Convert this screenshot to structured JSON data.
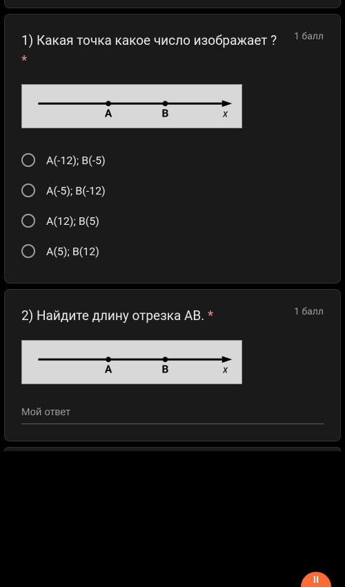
{
  "questions": [
    {
      "title": "1) Какая точка какое число изображает ?",
      "required": true,
      "points": "1 балл",
      "numberLine": {
        "pointA": "A",
        "pointB": "B",
        "axisLabel": "x"
      },
      "options": [
        "A(-12); B(-5)",
        "A(-5); B(-12)",
        "A(12); B(5)",
        "A(5); B(12)"
      ]
    },
    {
      "title": "2) Найдите длину отрезка АВ.",
      "required": true,
      "points": "1 балл",
      "numberLine": {
        "pointA": "A",
        "pointB": "B",
        "axisLabel": "x"
      },
      "inputPlaceholder": "Мой ответ"
    }
  ],
  "requiredMark": "*",
  "fabIcon": "II"
}
